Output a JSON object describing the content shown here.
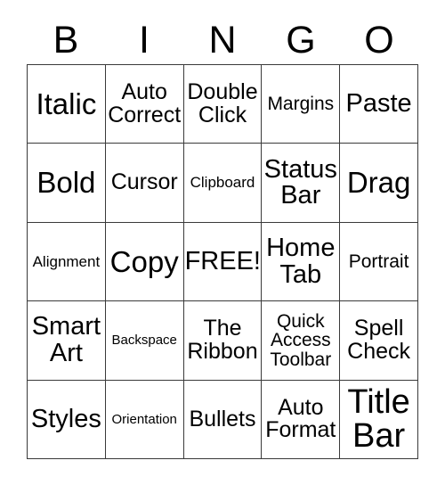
{
  "card": {
    "title": "BINGO",
    "header_letters": [
      "B",
      "I",
      "N",
      "G",
      "O"
    ],
    "border_color": "#3a3a3a",
    "background_color": "#ffffff",
    "text_color": "#000000",
    "columns": 5,
    "rows": 5,
    "free_space": "FREE!",
    "cells": [
      {
        "text": "Italic",
        "size": "xl"
      },
      {
        "text": "Auto\nCorrect",
        "size": "md"
      },
      {
        "text": "Double\nClick",
        "size": "md"
      },
      {
        "text": "Margins",
        "size": "sm"
      },
      {
        "text": "Paste",
        "size": "lg"
      },
      {
        "text": "Bold",
        "size": "xl"
      },
      {
        "text": "Cursor",
        "size": "md"
      },
      {
        "text": "Clipboard",
        "size": "xs"
      },
      {
        "text": "Status\nBar",
        "size": "lg"
      },
      {
        "text": "Drag",
        "size": "xl"
      },
      {
        "text": "Alignment",
        "size": "xs"
      },
      {
        "text": "Copy",
        "size": "xl"
      },
      {
        "text": "FREE!",
        "size": "lg"
      },
      {
        "text": "Home\nTab",
        "size": "lg"
      },
      {
        "text": "Portrait",
        "size": "sm"
      },
      {
        "text": "Smart\nArt",
        "size": "lg"
      },
      {
        "text": "Backspace",
        "size": "xxs"
      },
      {
        "text": "The\nRibbon",
        "size": "md"
      },
      {
        "text": "Quick\nAccess\nToolbar",
        "size": "sm"
      },
      {
        "text": "Spell\nCheck",
        "size": "md"
      },
      {
        "text": "Styles",
        "size": "lg"
      },
      {
        "text": "Orientation",
        "size": "xxs"
      },
      {
        "text": "Bullets",
        "size": "md"
      },
      {
        "text": "Auto\nFormat",
        "size": "md"
      },
      {
        "text": "Title\nBar",
        "size": "xxl"
      }
    ]
  }
}
